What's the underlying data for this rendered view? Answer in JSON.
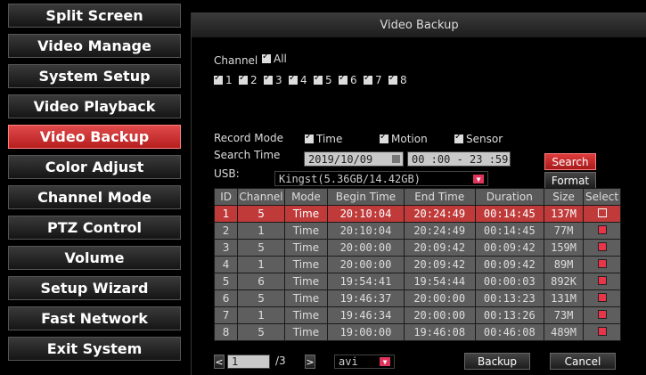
{
  "menu": {
    "items": [
      {
        "label": "Split Screen"
      },
      {
        "label": "Video Manage"
      },
      {
        "label": "System Setup"
      },
      {
        "label": "Video Playback"
      },
      {
        "label": "Video Backup"
      },
      {
        "label": "Color Adjust"
      },
      {
        "label": "Channel Mode"
      },
      {
        "label": "PTZ Control"
      },
      {
        "label": "Volume"
      },
      {
        "label": "Setup Wizard"
      },
      {
        "label": "Fast Network"
      },
      {
        "label": "Exit System"
      }
    ],
    "active_index": 4,
    "active_color": "#c8302f"
  },
  "panel": {
    "title": "Video Backup",
    "channel": {
      "label": "Channel",
      "all_label": "All",
      "channels": [
        "1",
        "2",
        "3",
        "4",
        "5",
        "6",
        "7",
        "8"
      ]
    },
    "record_mode": {
      "label": "Record Mode",
      "options": [
        "Time",
        "Motion",
        "Sensor"
      ]
    },
    "search_time": {
      "label": "Search Time",
      "date": "2019/10/09",
      "time_range": "00 :00 - 23 :59"
    },
    "usb": {
      "label": "USB:",
      "value": "Kingst(5.36GB/14.42GB)"
    },
    "buttons": {
      "search": "Search",
      "format": "Format",
      "backup": "Backup",
      "cancel": "Cancel"
    },
    "table": {
      "headers": [
        "ID",
        "Channel",
        "Mode",
        "Begin Time",
        "End Time",
        "Duration",
        "Size",
        "Select"
      ],
      "rows": [
        [
          "1",
          "5",
          "Time",
          "20:10:04",
          "20:24:49",
          "00:14:45",
          "137M"
        ],
        [
          "2",
          "1",
          "Time",
          "20:10:04",
          "20:24:49",
          "00:14:45",
          "77M"
        ],
        [
          "3",
          "5",
          "Time",
          "20:00:00",
          "20:09:42",
          "00:09:42",
          "159M"
        ],
        [
          "4",
          "1",
          "Time",
          "20:00:00",
          "20:09:42",
          "00:09:42",
          "89M"
        ],
        [
          "5",
          "6",
          "Time",
          "19:54:41",
          "19:54:44",
          "00:00:03",
          "892K"
        ],
        [
          "6",
          "5",
          "Time",
          "19:46:37",
          "20:00:00",
          "00:13:23",
          "131M"
        ],
        [
          "7",
          "1",
          "Time",
          "19:46:34",
          "20:00:00",
          "00:13:26",
          "73M"
        ],
        [
          "8",
          "5",
          "Time",
          "19:00:00",
          "19:46:08",
          "00:46:08",
          "489M"
        ]
      ],
      "selected_row_index": 0
    },
    "pager": {
      "prev_icon": "<",
      "next_icon": ">",
      "page": "1",
      "total": "/3"
    },
    "format_select": "avi"
  }
}
